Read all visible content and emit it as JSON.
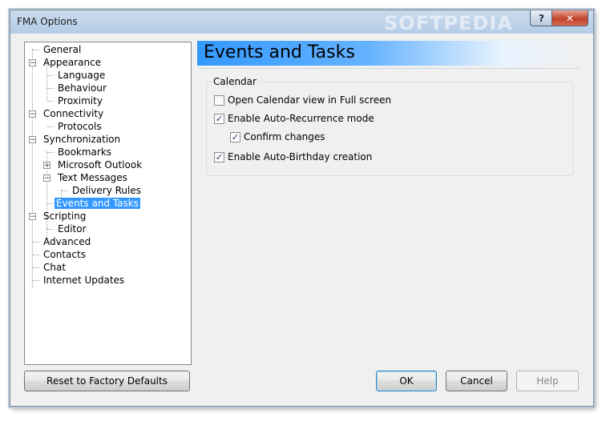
{
  "window": {
    "title": "FMA Options",
    "watermark": "SOFTPEDIA",
    "help_glyph": "?",
    "close_glyph": "✕"
  },
  "tree": {
    "items": [
      {
        "label": "General",
        "level": 0,
        "toggle": ""
      },
      {
        "label": "Appearance",
        "level": 0,
        "toggle": "−"
      },
      {
        "label": "Language",
        "level": 1,
        "toggle": ""
      },
      {
        "label": "Behaviour",
        "level": 1,
        "toggle": ""
      },
      {
        "label": "Proximity",
        "level": 1,
        "toggle": ""
      },
      {
        "label": "Connectivity",
        "level": 0,
        "toggle": "−"
      },
      {
        "label": "Protocols",
        "level": 1,
        "toggle": ""
      },
      {
        "label": "Synchronization",
        "level": 0,
        "toggle": "−"
      },
      {
        "label": "Bookmarks",
        "level": 1,
        "toggle": ""
      },
      {
        "label": "Microsoft Outlook",
        "level": 1,
        "toggle": "+"
      },
      {
        "label": "Text Messages",
        "level": 1,
        "toggle": "−"
      },
      {
        "label": "Delivery Rules",
        "level": 2,
        "toggle": ""
      },
      {
        "label": "Events and Tasks",
        "level": 1,
        "toggle": "",
        "selected": true
      },
      {
        "label": "Scripting",
        "level": 0,
        "toggle": "−"
      },
      {
        "label": "Editor",
        "level": 1,
        "toggle": ""
      },
      {
        "label": "Advanced",
        "level": 0,
        "toggle": ""
      },
      {
        "label": "Contacts",
        "level": 0,
        "toggle": ""
      },
      {
        "label": "Chat",
        "level": 0,
        "toggle": ""
      },
      {
        "label": "Internet Updates",
        "level": 0,
        "toggle": ""
      }
    ]
  },
  "panel": {
    "title": "Events and Tasks",
    "group_label": "Calendar",
    "options": [
      {
        "label": "Open Calendar view in Full screen",
        "checked": false
      },
      {
        "label": "Enable Auto-Recurrence mode",
        "checked": true
      },
      {
        "label": "Confirm changes",
        "checked": true
      },
      {
        "label": "Enable Auto-Birthday creation",
        "checked": true
      }
    ]
  },
  "buttons": {
    "reset": "Reset to Factory Defaults",
    "ok": "OK",
    "cancel": "Cancel",
    "help": "Help"
  }
}
